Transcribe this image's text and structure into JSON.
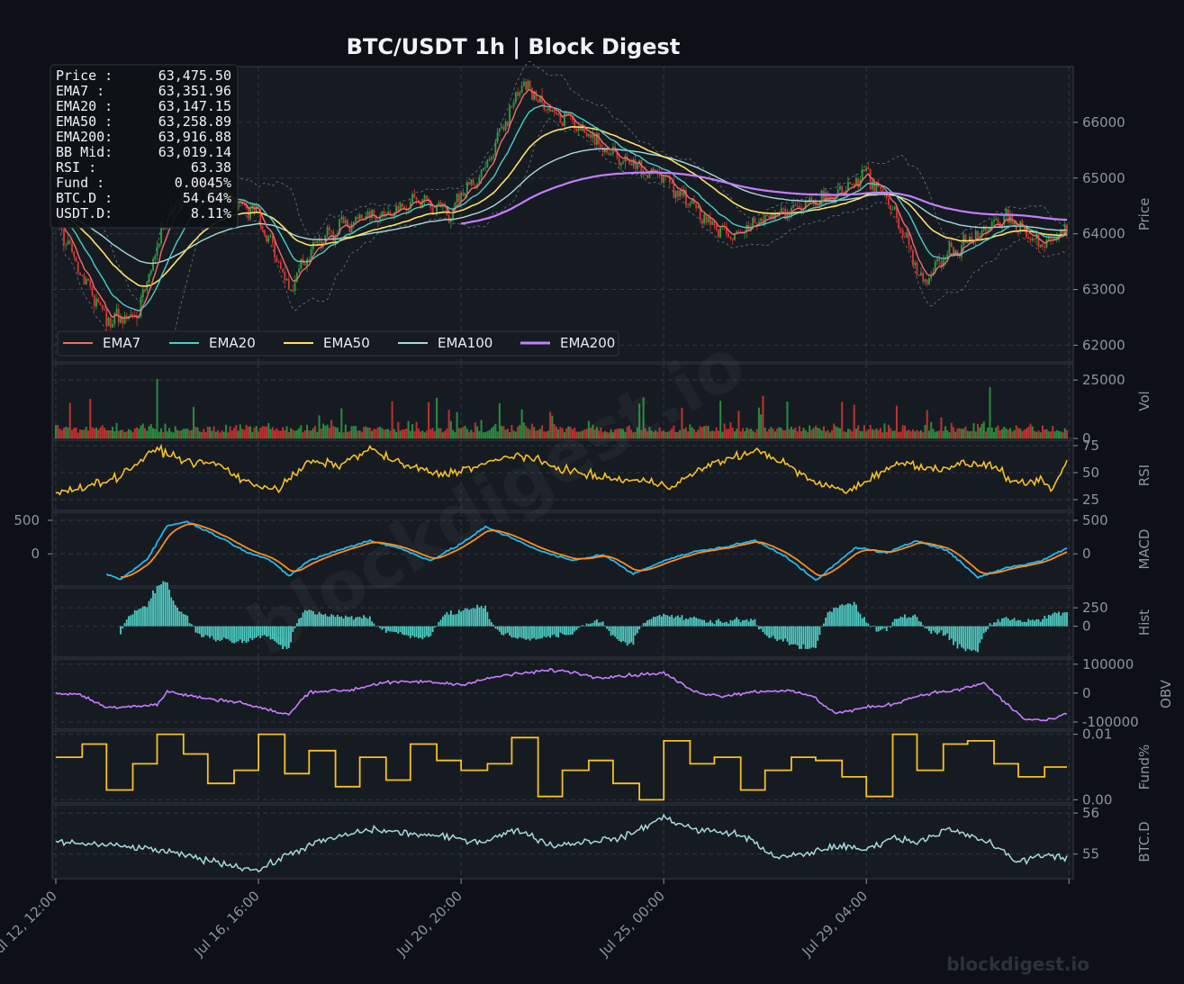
{
  "chart_data": {
    "type": "line",
    "title": "BTC/USDT  1h  |  Block Digest",
    "x_ticks": [
      "Jul 12, 12:00",
      "Jul 16, 16:00",
      "Jul 20, 20:00",
      "Jul 25, 00:00",
      "Jul 29, 04:00"
    ],
    "watermark": "blockdigest.io",
    "footer": "blockdigest.io",
    "info_box": [
      {
        "label": "Price :",
        "value": "63,475.50"
      },
      {
        "label": "EMA7  :",
        "value": "63,351.96"
      },
      {
        "label": "EMA20 :",
        "value": "63,147.15"
      },
      {
        "label": "EMA50 :",
        "value": "63,258.89"
      },
      {
        "label": "EMA200:",
        "value": "63,916.88"
      },
      {
        "label": "BB Mid:",
        "value": "63,019.14"
      },
      {
        "label": "RSI   :",
        "value": "63.38"
      },
      {
        "label": "Fund  :",
        "value": "0.0045%"
      },
      {
        "label": "BTC.D :",
        "value": "54.64%"
      },
      {
        "label": "USDT.D:",
        "value": "8.11%"
      }
    ],
    "colors": {
      "ema7": "#f26b6b",
      "ema20": "#4ecdc4",
      "ema50": "#ffe066",
      "ema100": "#a8dadc",
      "ema200": "#c77dff",
      "up": "#2ea043",
      "down": "#da3633",
      "rsi": "#f6c026",
      "macd": "#22b8f0",
      "signal": "#ff8c1a",
      "hist": "#4ecdc4",
      "obv": "#c77dff",
      "fund": "#f6c026",
      "btcd": "#a8dadc",
      "bb": "#6e7681"
    },
    "price_panel": {
      "ylabel": "Price",
      "ylim": [
        61700,
        67000
      ],
      "yticks": [
        "62000",
        "63000",
        "64000",
        "65000",
        "66000"
      ],
      "anchors_x": [
        0,
        12,
        25,
        40,
        54,
        68,
        82,
        100,
        115,
        130,
        145,
        162,
        178,
        195,
        212,
        230,
        245,
        262,
        280,
        300,
        320,
        335,
        350,
        368,
        385,
        400,
        414,
        428,
        442,
        455,
        470,
        485,
        500
      ],
      "anchors_close": [
        64300,
        63300,
        62450,
        62500,
        64300,
        64900,
        64700,
        64400,
        63000,
        63900,
        64200,
        64300,
        64600,
        64400,
        65200,
        66700,
        66200,
        65800,
        65300,
        65000,
        64300,
        63900,
        64300,
        64500,
        64700,
        65100,
        64400,
        63100,
        63700,
        64000,
        64300,
        63800,
        64100
      ],
      "legend": [
        "EMA7",
        "EMA20",
        "EMA50",
        "EMA100",
        "EMA200"
      ],
      "n_candles": 500
    },
    "volume_panel": {
      "ylabel": "Vol",
      "ylim": [
        0,
        32000
      ],
      "yticks": [
        "0",
        "25000"
      ]
    },
    "rsi_panel": {
      "ylabel": "RSI",
      "ylim": [
        15,
        80
      ],
      "yticks": [
        "25",
        "50",
        "75"
      ],
      "anchors_x": [
        0,
        15,
        30,
        50,
        65,
        80,
        95,
        110,
        125,
        140,
        155,
        170,
        190,
        210,
        228,
        245,
        262,
        275,
        290,
        305,
        320,
        335,
        348,
        360,
        375,
        392,
        408,
        420,
        432,
        448,
        462,
        475,
        485,
        492,
        500
      ],
      "anchors_y": [
        30,
        38,
        45,
        72,
        60,
        58,
        40,
        35,
        60,
        57,
        72,
        58,
        48,
        57,
        67,
        56,
        48,
        44,
        42,
        38,
        55,
        65,
        70,
        58,
        40,
        33,
        52,
        60,
        53,
        58,
        57,
        38,
        43,
        35,
        63
      ]
    },
    "macd_panel": {
      "ylabel": "MACD",
      "ylim": [
        -480,
        620
      ],
      "yticks_left": [
        "500",
        "0"
      ],
      "yticks_right": [
        "500",
        "0"
      ],
      "anchors_x": [
        25,
        32,
        45,
        55,
        65,
        80,
        95,
        105,
        115,
        125,
        140,
        155,
        170,
        185,
        200,
        212,
        225,
        240,
        255,
        270,
        285,
        300,
        315,
        330,
        345,
        360,
        375,
        385,
        395,
        410,
        425,
        440,
        455,
        470,
        485,
        500
      ],
      "anchors_macd": [
        -300,
        -380,
        -80,
        420,
        480,
        260,
        20,
        -80,
        -330,
        -100,
        60,
        200,
        80,
        -100,
        150,
        400,
        240,
        30,
        -100,
        -10,
        -300,
        -100,
        30,
        100,
        200,
        -30,
        -400,
        -150,
        100,
        10,
        200,
        50,
        -350,
        -200,
        -120,
        100
      ]
    },
    "hist_panel": {
      "ylabel": "Hist",
      "ylim": [
        -420,
        520
      ],
      "yticks": [
        "0",
        "250"
      ]
    },
    "obv_panel": {
      "ylabel": "OBV",
      "ylim": [
        -125000,
        118000
      ],
      "yticks": [
        "-100000",
        "0",
        "100000"
      ],
      "anchors_x": [
        0,
        12,
        25,
        50,
        55,
        75,
        90,
        100,
        115,
        125,
        145,
        160,
        180,
        200,
        220,
        245,
        258,
        265,
        280,
        300,
        315,
        328,
        345,
        360,
        373,
        385,
        400,
        412,
        425,
        432,
        445,
        458,
        468,
        478,
        490,
        500
      ],
      "anchors_y": [
        0,
        -5000,
        -50000,
        -40000,
        5000,
        -20000,
        -30000,
        -50000,
        -75000,
        5000,
        10000,
        35000,
        40000,
        30000,
        60000,
        80000,
        70000,
        55000,
        60000,
        70000,
        5000,
        -10000,
        5000,
        10000,
        -10000,
        -70000,
        -50000,
        -40000,
        -10000,
        0,
        10000,
        35000,
        -30000,
        -90000,
        -95000,
        -70000
      ]
    },
    "fund_panel": {
      "ylabel": "Fund%",
      "ylim": [
        -0.0005,
        0.0105
      ],
      "yticks": [
        "0.00",
        "0.01"
      ],
      "levels": [
        0.0065,
        0.0085,
        0.0015,
        0.0055,
        0.01,
        0.007,
        0.0025,
        0.0045,
        0.01,
        0.004,
        0.0075,
        0.002,
        0.0065,
        0.003,
        0.0085,
        0.006,
        0.0045,
        0.0055,
        0.0095,
        0.0005,
        0.0045,
        0.006,
        0.0025,
        0.0,
        0.009,
        0.0055,
        0.0065,
        0.0015,
        0.0045,
        0.0065,
        0.006,
        0.0035,
        0.0005,
        0.01,
        0.0045,
        0.0085,
        0.009,
        0.0055,
        0.0035,
        0.005
      ]
    },
    "btcd_panel": {
      "ylabel": "BTC.D",
      "ylim": [
        54.4,
        56.2
      ],
      "yticks": [
        "55",
        "56"
      ],
      "anchors_x": [
        0,
        30,
        50,
        70,
        90,
        100,
        115,
        130,
        155,
        175,
        195,
        210,
        228,
        245,
        260,
        280,
        300,
        315,
        335,
        345,
        355,
        370,
        385,
        400,
        412,
        425,
        440,
        460,
        475,
        488,
        500
      ],
      "anchors_y": [
        55.3,
        55.2,
        55.1,
        54.9,
        54.7,
        54.6,
        55.0,
        55.3,
        55.6,
        55.5,
        55.4,
        55.3,
        55.6,
        55.2,
        55.3,
        55.4,
        55.9,
        55.6,
        55.5,
        55.3,
        54.9,
        55.0,
        55.2,
        55.1,
        55.4,
        55.3,
        55.6,
        55.3,
        54.8,
        55.0,
        54.9
      ]
    }
  }
}
